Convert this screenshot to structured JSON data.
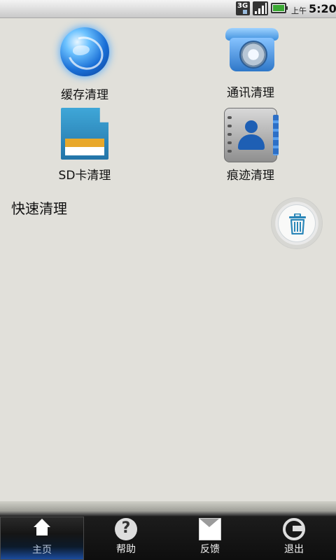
{
  "status_bar": {
    "network": "3G",
    "ampm": "上午",
    "time": "5:20"
  },
  "tiles": [
    {
      "label": "缓存清理",
      "icon": "globe-icon"
    },
    {
      "label": "通讯清理",
      "icon": "telephone-icon"
    },
    {
      "label": "SD卡清理",
      "icon": "sd-card-icon"
    },
    {
      "label": "痕迹清理",
      "icon": "contacts-book-icon"
    }
  ],
  "quick_clean": {
    "title": "快速清理",
    "button_icon": "trash-icon"
  },
  "bottom_nav": [
    {
      "label": "主页",
      "icon": "home-icon",
      "active": true
    },
    {
      "label": "帮助",
      "icon": "help-icon",
      "active": false
    },
    {
      "label": "反馈",
      "icon": "mail-icon",
      "active": false
    },
    {
      "label": "退出",
      "icon": "exit-icon",
      "active": false
    }
  ],
  "colors": {
    "background": "#e1e0da",
    "accent": "#2a86b8",
    "nav_bg": "#111111"
  }
}
